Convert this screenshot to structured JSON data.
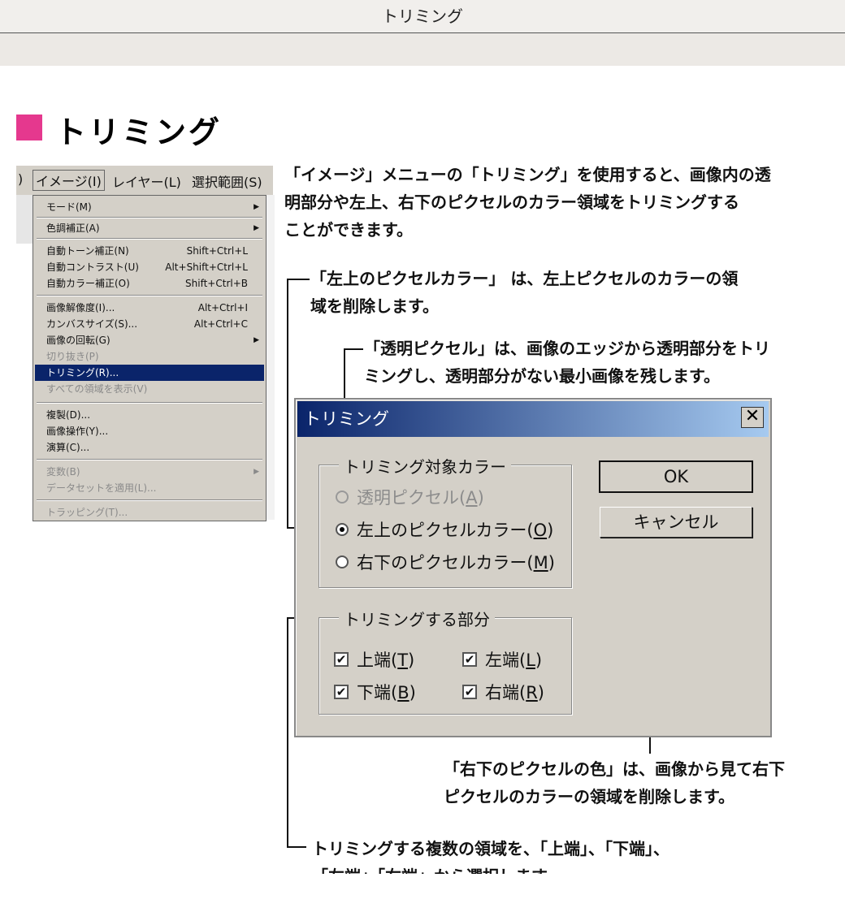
{
  "window": {
    "title": "トリミング"
  },
  "heading": "トリミング",
  "menubar": {
    "partial_left": ")",
    "items": [
      "イメージ(I)",
      "レイヤー(L)",
      "選択範囲(S)"
    ]
  },
  "image_menu": {
    "items": [
      {
        "label": "モード(M)",
        "submenu": true
      },
      {
        "label": "色調補正(A)",
        "submenu": true
      },
      {
        "label": "自動トーン補正(N)",
        "shortcut": "Shift+Ctrl+L"
      },
      {
        "label": "自動コントラスト(U)",
        "shortcut": "Alt+Shift+Ctrl+L"
      },
      {
        "label": "自動カラー補正(O)",
        "shortcut": "Shift+Ctrl+B"
      },
      {
        "label": "画像解像度(I)...",
        "shortcut": "Alt+Ctrl+I"
      },
      {
        "label": "カンバスサイズ(S)...",
        "shortcut": "Alt+Ctrl+C"
      },
      {
        "label": "画像の回転(G)",
        "submenu": true
      },
      {
        "label": "切り抜き(P)",
        "disabled": true
      },
      {
        "label": "トリミング(R)...",
        "selected": true
      },
      {
        "label": "すべての領域を表示(V)",
        "disabled": true
      },
      {
        "label": "複製(D)..."
      },
      {
        "label": "画像操作(Y)..."
      },
      {
        "label": "演算(C)..."
      },
      {
        "label": "変数(B)",
        "disabled": true,
        "submenu": true
      },
      {
        "label": "データセットを適用(L)...",
        "disabled": true
      },
      {
        "label": "トラッピング(T)...",
        "disabled": true
      }
    ]
  },
  "description": [
    "「イメージ」メニューの「トリミング」を使用すると、画像内の透",
    "明部分や左上、右下のピクセルのカラー領域をトリミングする",
    "ことができます。"
  ],
  "callouts": {
    "top_left": [
      "「左上のピクセルカラー」 は、左上ピクセルのカラーの領",
      "域を削除します。"
    ],
    "transparent": [
      "「透明ピクセル」は、画像のエッジから透明部分をトリ",
      "ミングし、透明部分がない最小画像を残します。"
    ],
    "bottom_right": [
      "「右下のピクセルの色」は、画像から見て右下",
      "ピクセルのカラーの領域を削除します。"
    ],
    "trim_parts": [
      "トリミングする複数の領域を、「上端」、「下端」、",
      "「左端」「右端」から選択します。"
    ]
  },
  "dialog": {
    "title": "トリミング",
    "close_glyph": "✕",
    "ok_label": "OK",
    "cancel_label": "キャンセル",
    "based_on": {
      "label": "トリミング対象カラー",
      "options": [
        {
          "text": "透明ピクセル(",
          "key": "A",
          "end": ")",
          "disabled": true,
          "checked": false
        },
        {
          "text": "左上のピクセルカラー(",
          "key": "O",
          "end": ")",
          "disabled": false,
          "checked": true
        },
        {
          "text": "右下のピクセルカラー(",
          "key": "M",
          "end": ")",
          "disabled": false,
          "checked": false
        }
      ]
    },
    "trim_away": {
      "label": "トリミングする部分",
      "options": [
        {
          "text": "上端(",
          "key": "T",
          "end": ")",
          "checked": true
        },
        {
          "text": "左端(",
          "key": "L",
          "end": ")",
          "checked": true
        },
        {
          "text": "下端(",
          "key": "B",
          "end": ")",
          "checked": true
        },
        {
          "text": "右端(",
          "key": "R",
          "end": ")",
          "checked": true
        }
      ]
    },
    "check_glyph": "✔"
  }
}
